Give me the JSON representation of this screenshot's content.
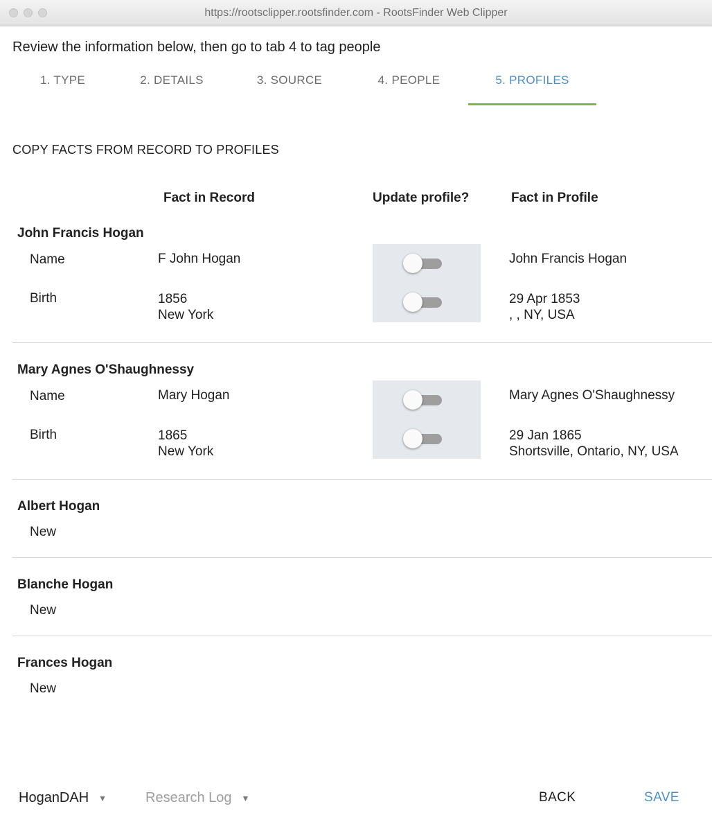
{
  "window": {
    "title": "https://rootsclipper.rootsfinder.com - RootsFinder Web Clipper"
  },
  "instruction": "Review the information below, then go to tab 4 to tag people",
  "tabs": [
    {
      "label": "1. TYPE",
      "active": false
    },
    {
      "label": "2. DETAILS",
      "active": false
    },
    {
      "label": "3. SOURCE",
      "active": false
    },
    {
      "label": "4. PEOPLE",
      "active": false
    },
    {
      "label": "5. PROFILES",
      "active": true
    }
  ],
  "section_title": "COPY FACTS FROM RECORD TO PROFILES",
  "columns": {
    "fact_in_record": "Fact in Record",
    "update_profile": "Update profile?",
    "fact_in_profile": "Fact in Profile"
  },
  "people": [
    {
      "name": "John Francis Hogan",
      "facts": [
        {
          "label": "Name",
          "record": [
            "F John Hogan"
          ],
          "update": false,
          "profile": [
            "John Francis Hogan"
          ]
        },
        {
          "label": "Birth",
          "record": [
            "1856",
            "New York"
          ],
          "update": false,
          "profile": [
            "29 Apr 1853",
            ", , NY, USA"
          ]
        }
      ]
    },
    {
      "name": "Mary Agnes O'Shaughnessy",
      "facts": [
        {
          "label": "Name",
          "record": [
            "Mary Hogan"
          ],
          "update": false,
          "profile": [
            "Mary Agnes O'Shaughnessy"
          ]
        },
        {
          "label": "Birth",
          "record": [
            "1865",
            "New York"
          ],
          "update": false,
          "profile": [
            "29 Jan 1865",
            "Shortsville, Ontario, NY, USA"
          ]
        }
      ]
    },
    {
      "name": "Albert Hogan",
      "status": "New"
    },
    {
      "name": "Blanche Hogan",
      "status": "New"
    },
    {
      "name": "Frances Hogan",
      "status": "New"
    }
  ],
  "footer": {
    "tree_select": "HoganDAH",
    "log_select": "Research Log",
    "back_label": "BACK",
    "save_label": "SAVE"
  },
  "colors": {
    "accent": "#4a90c4",
    "tab_underline": "#7ab648",
    "toggle_off": "#9e9e9e",
    "toggle_panel": "#e5e8ec"
  }
}
